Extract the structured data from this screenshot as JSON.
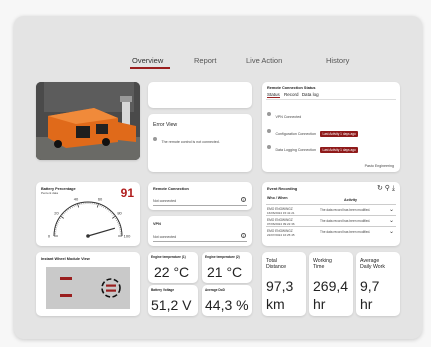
{
  "nav": {
    "tabs": [
      {
        "label": "Overview",
        "active": true
      },
      {
        "label": "Report",
        "active": false
      },
      {
        "label": "Live Action",
        "active": false
      },
      {
        "label": "History",
        "active": false
      }
    ]
  },
  "error_view": {
    "title": "Error View",
    "message": "The remote control is not connected."
  },
  "remote_status": {
    "heading": "Remote Connection Status",
    "tabs": [
      "Status",
      "Record",
      "Data log"
    ],
    "rows": [
      {
        "label": "VPN Connected",
        "badge": ""
      },
      {
        "label": "Configuration Connection",
        "badge": "Last Activity 1 days ago"
      },
      {
        "label": "Data Logging Connection",
        "badge": "Last Activity 1 days ago"
      }
    ],
    "footer": "Pasto Engineering"
  },
  "battery": {
    "title": "Battery Percentage",
    "subtitle": "Percent data",
    "value": "91",
    "gauge_labels": [
      "0",
      "20",
      "40",
      "60",
      "80",
      "100"
    ],
    "level_percent": 91
  },
  "remote_connection": {
    "title": "Remote Connection",
    "value": "Not connected"
  },
  "vpn": {
    "title": "VPN",
    "value": "Not connected"
  },
  "events": {
    "title": "Event Recording",
    "col_who": "Who",
    "col_when": "When",
    "col_activity": "Activity",
    "rows": [
      {
        "who": "EMO ENGWINGZ",
        "when": "16/06/2024 15:41:21",
        "activity": "The data record has been modified."
      },
      {
        "who": "EMO ENGWINGZ",
        "when": "07/06/2024 09:22:36",
        "activity": "The data record has been modified."
      },
      {
        "who": "EMO ENGWINGZ",
        "when": "22/07/2024 16:25:45",
        "activity": "The data record has been modified."
      }
    ]
  },
  "wheel": {
    "title": "Instant Wheel Module View"
  },
  "metrics": [
    {
      "label": "Engine temperature (1)",
      "value": "22 °C"
    },
    {
      "label": "Engine temperature (2)",
      "value": "21 °C"
    },
    {
      "label": "Battery Voltage",
      "value": "51,2 V"
    },
    {
      "label": "Average DoD",
      "value": "44,3 %"
    }
  ],
  "totals": [
    {
      "label_1": "Total",
      "label_2": "Distance",
      "value": "97,3",
      "unit": "km"
    },
    {
      "label_1": "Working",
      "label_2": "Time",
      "value": "269,4",
      "unit": "hr"
    },
    {
      "label_1": "Average",
      "label_2": "Daily Work",
      "value": "9,7",
      "unit": "hr"
    }
  ],
  "colors": {
    "accent": "#9a1f1f",
    "badge": "#8f1a1a",
    "battery_value": "#b01c1c",
    "wheel_panel": "#c9c9c9"
  }
}
